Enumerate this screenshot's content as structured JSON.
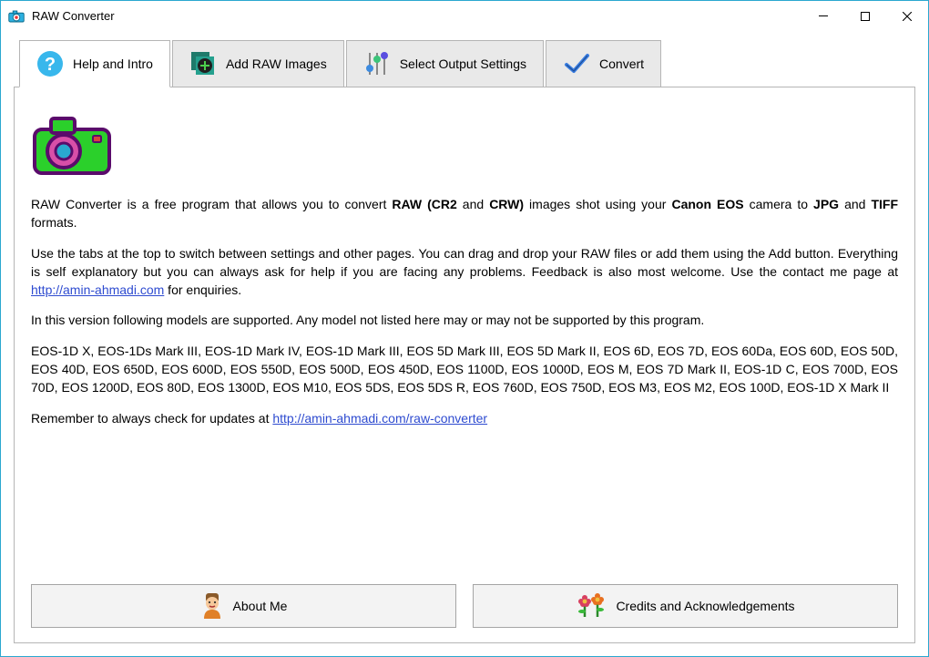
{
  "window": {
    "title": "RAW Converter"
  },
  "tabs": [
    {
      "label": "Help and Intro"
    },
    {
      "label": "Add RAW Images"
    },
    {
      "label": "Select Output Settings"
    },
    {
      "label": "Convert"
    }
  ],
  "intro": {
    "p1_pre": "RAW Converter is a free program that allows you to convert ",
    "p1_b1": "RAW (CR2",
    "p1_mid1": " and ",
    "p1_b2": "CRW)",
    "p1_mid2": " images shot using your ",
    "p1_b3": "Canon EOS",
    "p1_mid3": " camera to ",
    "p1_b4": "JPG",
    "p1_mid4": " and ",
    "p1_b5": "TIFF",
    "p1_post": " formats.",
    "p2_pre": "Use the tabs at the top to switch between settings and other pages. You can drag and drop your RAW files or add them using the Add button. Everything is self explanatory but you can always ask for help if you are facing any problems. Feedback is also most welcome. Use the contact me page at ",
    "p2_link": "http://amin-ahmadi.com",
    "p2_post": " for enquiries.",
    "p3": "In this version following models are supported. Any model not listed here may or may not be supported by this program.",
    "p4": "EOS-1D X, EOS-1Ds Mark III, EOS-1D Mark IV, EOS-1D Mark III, EOS 5D Mark III, EOS 5D Mark II, EOS 6D, EOS 7D, EOS 60Da, EOS 60D, EOS 50D, EOS 40D, EOS 650D, EOS 600D, EOS 550D, EOS 500D, EOS 450D, EOS 1100D, EOS 1000D, EOS M, EOS 7D Mark II, EOS-1D C, EOS 700D, EOS 70D, EOS 1200D, EOS 80D, EOS 1300D, EOS M10, EOS 5DS, EOS 5DS R, EOS 760D, EOS 750D, EOS M3, EOS M2, EOS 100D, EOS-1D X Mark II",
    "p5_pre": "Remember to always check for updates at ",
    "p5_link": "http://amin-ahmadi.com/raw-converter"
  },
  "buttons": {
    "about": "About Me",
    "credits": "Credits and Acknowledgements"
  }
}
